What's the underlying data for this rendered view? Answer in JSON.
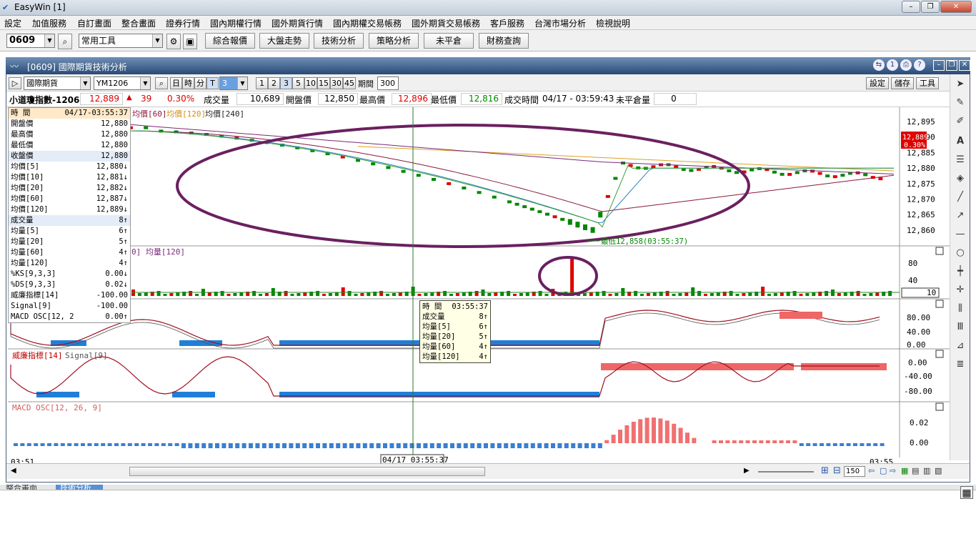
{
  "app": {
    "title": "EasyWin  [1]"
  },
  "menu": [
    "設定",
    "加值服務",
    "自訂畫面",
    "整合畫面",
    "證券行情",
    "國內期權行情",
    "國外期貨行情",
    "國內期權交易帳務",
    "國外期貨交易帳務",
    "客戶服務",
    "台灣市場分析",
    "檢視說明"
  ],
  "toolbar": {
    "code": "0609",
    "tools_combo": "常用工具",
    "buttons": [
      "綜合報價",
      "大盤走勢",
      "技術分析",
      "策略分析",
      "未平倉",
      "財務查詢"
    ]
  },
  "child": {
    "title": "[0609] 國際期貨技術分析",
    "market_combo": "國際期貨",
    "symbol_combo": "YM1206",
    "period_buttons": [
      "日",
      "時",
      "分",
      "T"
    ],
    "tick_buttons": [
      "1",
      "2",
      "3",
      "5",
      "10",
      "15",
      "30",
      "45"
    ],
    "period_label": "期間",
    "period_value": "300",
    "right_buttons": [
      "設定",
      "儲存",
      "工具"
    ]
  },
  "quote": {
    "name": "小道瓊指數-1206",
    "price": "12,889",
    "change": "39",
    "pct": "0.30%",
    "volume_label": "成交量",
    "volume": "10,689",
    "open_label": "開盤價",
    "open": "12,850",
    "high_label": "最高價",
    "high": "12,896",
    "low_label": "最低價",
    "low": "12,816",
    "time_label": "成交時間",
    "time": "04/17 - 03:59:43",
    "oi_label": "未平倉量",
    "oi": "0"
  },
  "datapanel": [
    {
      "l": "時  間",
      "v": "04/17-03:55:37",
      "hl": true
    },
    {
      "l": "開盤價",
      "v": "12,880"
    },
    {
      "l": "最高價",
      "v": "12,880"
    },
    {
      "l": "最低價",
      "v": "12,880"
    },
    {
      "l": "收盤價",
      "v": "12,880",
      "hl": true
    },
    {
      "l": "均價[5]",
      "v": "12,880↓"
    },
    {
      "l": "均價[10]",
      "v": "12,881↓"
    },
    {
      "l": "均價[20]",
      "v": "12,882↓"
    },
    {
      "l": "均價[60]",
      "v": "12,887↓"
    },
    {
      "l": "均價[120]",
      "v": "12,889↓"
    },
    {
      "l": "成交量",
      "v": "8↑",
      "hl": true
    },
    {
      "l": "均量[5]",
      "v": "6↑"
    },
    {
      "l": "均量[20]",
      "v": "5↑"
    },
    {
      "l": "均量[60]",
      "v": "4↑"
    },
    {
      "l": "均量[120]",
      "v": "4↑"
    },
    {
      "l": "%KS[9,3,3]",
      "v": "0.00↓"
    },
    {
      "l": "%DS[9,3,3]",
      "v": "0.02↓"
    },
    {
      "l": "威廉指標[14]",
      "v": "-100.00"
    },
    {
      "l": "Signal[9]",
      "v": "-100.00"
    },
    {
      "l": "MACD OSC[12, 2",
      "v": "0.00↑"
    }
  ],
  "panels": {
    "price_legend": [
      "均價[60]",
      "均價[120]",
      "均價[240]"
    ],
    "price_axis": [
      "12,895",
      "12,890",
      "12,885",
      "12,880",
      "12,875",
      "12,870",
      "12,865",
      "12,860"
    ],
    "price_tag": "12,889",
    "price_tag_pct": "0.30%",
    "low_marker": "最低12,858(03:55:37)",
    "vol_legend": "0] 均量[120]",
    "vol_axis": [
      "80",
      "40"
    ],
    "vol_box": "10",
    "kd_axis": [
      "80.00",
      "40.00",
      "0.00"
    ],
    "wr_legend": "威廉指標[14]",
    "wr_signal": "Signal[9]",
    "wr_axis": [
      "0.00",
      "-40.00",
      "-80.00"
    ],
    "macd_legend": "MACD OSC[12, 26, 9]",
    "macd_axis": [
      "0.02",
      "0.00"
    ],
    "x_start": "03:51",
    "x_cursor": "04/17 03:55:37",
    "x_end": "03:55"
  },
  "popup": [
    {
      "l": "時  間",
      "v": "03:55:37"
    },
    {
      "l": "成交量",
      "v": "8↑"
    },
    {
      "l": "均量[5]",
      "v": "6↑"
    },
    {
      "l": "均量[20]",
      "v": "5↑"
    },
    {
      "l": "均量[60]",
      "v": "4↑"
    },
    {
      "l": "均量[120]",
      "v": "4↑"
    }
  ],
  "status": {
    "zoom": "150"
  },
  "taskbar": {
    "tab1": "整合畫面",
    "tab2": "技術分析"
  },
  "colors": {
    "up": "#e00000",
    "down": "#008800",
    "ellipse": "#6a2060",
    "ma60": "#8b1a3a",
    "ma120": "#e0a020",
    "ma240": "#7a2a7a",
    "kd_fill": "#1f7fd8"
  }
}
